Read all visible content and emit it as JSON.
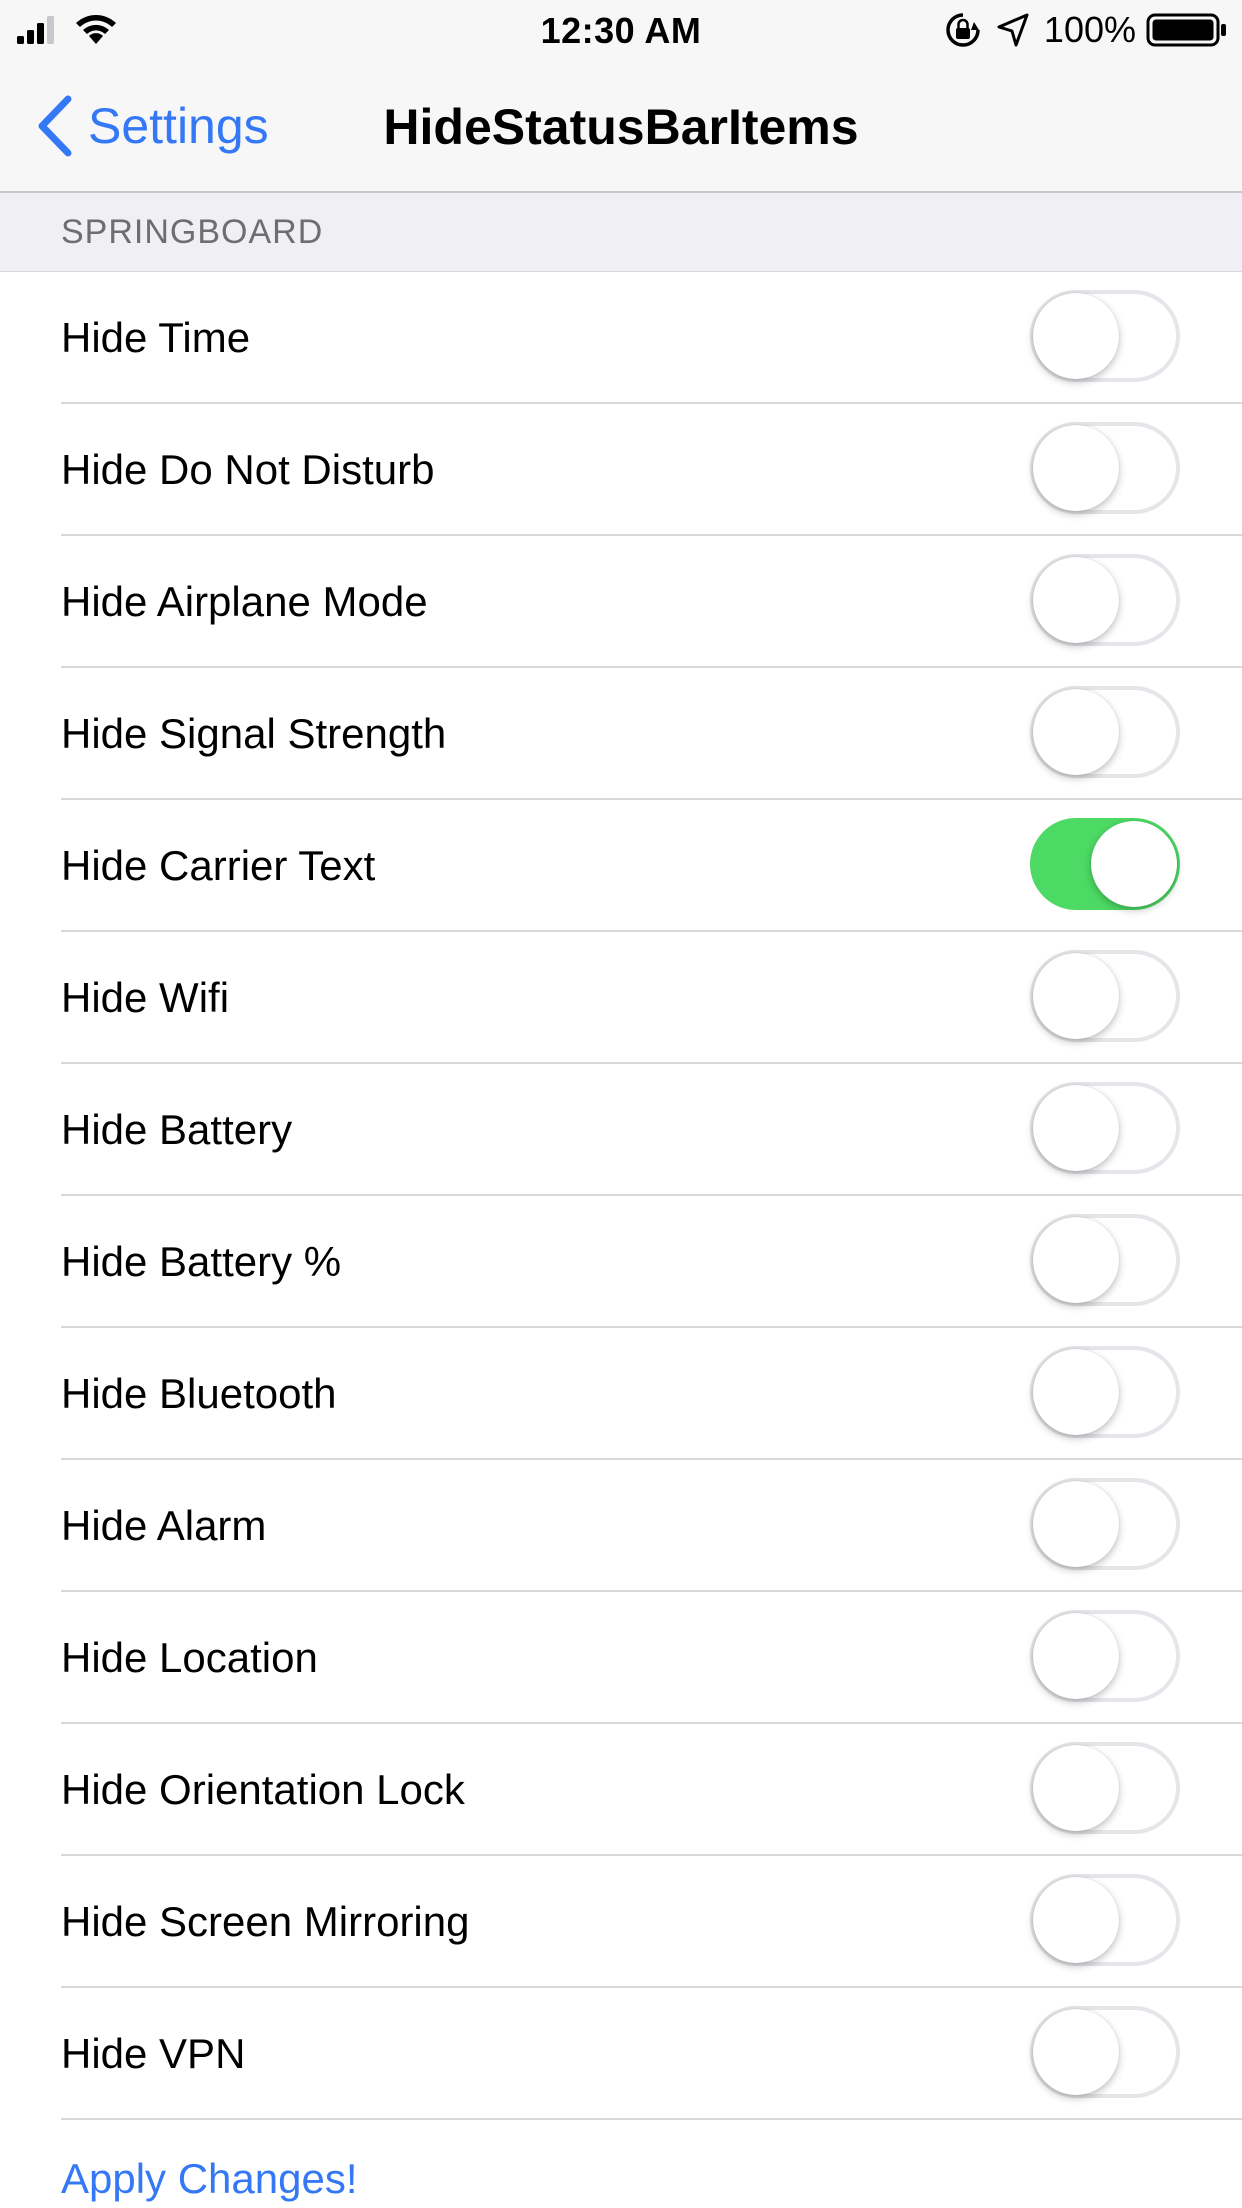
{
  "status_bar": {
    "time": "12:30 AM",
    "battery_percent": "100%",
    "icons": [
      "cellular-signal-icon",
      "wifi-icon",
      "orientation-lock-icon",
      "location-arrow-icon",
      "battery-icon"
    ]
  },
  "nav": {
    "back_label": "Settings",
    "title": "HideStatusBarItems"
  },
  "section": {
    "header": "SPRINGBOARD"
  },
  "rows": [
    {
      "label": "Hide Time",
      "on": false
    },
    {
      "label": "Hide Do Not Disturb",
      "on": false
    },
    {
      "label": "Hide Airplane Mode",
      "on": false
    },
    {
      "label": "Hide Signal Strength",
      "on": false
    },
    {
      "label": "Hide Carrier Text",
      "on": true
    },
    {
      "label": "Hide Wifi",
      "on": false
    },
    {
      "label": "Hide Battery",
      "on": false
    },
    {
      "label": "Hide Battery %",
      "on": false
    },
    {
      "label": "Hide Bluetooth",
      "on": false
    },
    {
      "label": "Hide Alarm",
      "on": false
    },
    {
      "label": "Hide Location",
      "on": false
    },
    {
      "label": "Hide Orientation Lock",
      "on": false
    },
    {
      "label": "Hide Screen Mirroring",
      "on": false
    },
    {
      "label": "Hide VPN",
      "on": false
    }
  ],
  "apply_label": "Apply Changes!",
  "colors": {
    "accent": "#3478f6",
    "toggle_on": "#4cd964",
    "background": "#efeff4"
  }
}
